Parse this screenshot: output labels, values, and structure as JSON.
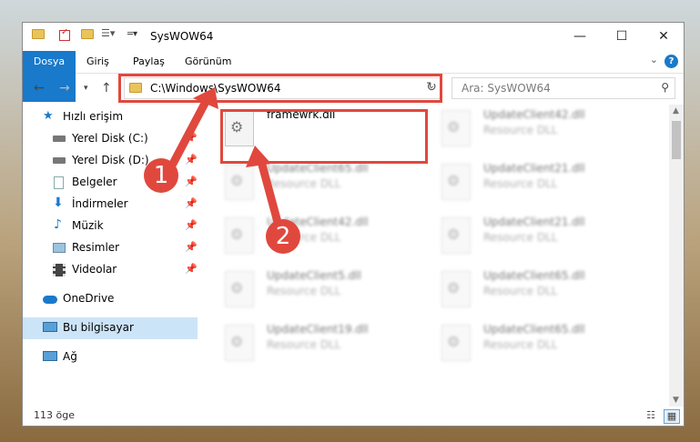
{
  "window": {
    "title": "SysWOW64"
  },
  "ribbon": {
    "tabs": [
      {
        "label": "Dosya"
      },
      {
        "label": "Giriş"
      },
      {
        "label": "Paylaş"
      },
      {
        "label": "Görünüm"
      }
    ],
    "help": "?"
  },
  "address": {
    "path": "C:\\Windows\\SysWOW64"
  },
  "search": {
    "placeholder": "Ara: SysWOW64"
  },
  "nav": {
    "quick_access": "Hızlı erişim",
    "items": [
      {
        "label": "Yerel Disk (C:)",
        "icon": "drive-icon"
      },
      {
        "label": "Yerel Disk (D:)",
        "icon": "drive-icon"
      },
      {
        "label": "Belgeler",
        "icon": "documents-icon"
      },
      {
        "label": "İndirmeler",
        "icon": "downloads-icon"
      },
      {
        "label": "Müzik",
        "icon": "music-icon"
      },
      {
        "label": "Resimler",
        "icon": "pictures-icon"
      },
      {
        "label": "Videolar",
        "icon": "videos-icon"
      }
    ],
    "onedrive": "OneDrive",
    "this_pc": "Bu bilgisayar",
    "network": "Ağ"
  },
  "files": {
    "highlighted": {
      "name": "framewrk.dll"
    },
    "left": [
      {
        "name": "UpdateClient65.dll",
        "type": "Resource DLL"
      },
      {
        "name": "UpdateClient42.dll",
        "type": "Resource DLL"
      },
      {
        "name": "UpdateClient5.dll",
        "type": "Resource DLL"
      },
      {
        "name": "UpdateClient19.dll",
        "type": "Resource DLL"
      }
    ],
    "right": [
      {
        "name": "UpdateClient42.dll",
        "type": "Resource DLL"
      },
      {
        "name": "UpdateClient21.dll",
        "type": "Resource DLL"
      },
      {
        "name": "UpdateClient21.dll",
        "type": "Resource DLL"
      },
      {
        "name": "UpdateClient65.dll",
        "type": "Resource DLL"
      },
      {
        "name": "UpdateClient65.dll",
        "type": "Resource DLL"
      }
    ]
  },
  "status": {
    "count": "113 öge"
  },
  "callouts": {
    "one": "1",
    "two": "2"
  },
  "colors": {
    "accent": "#1979ca",
    "highlight": "#e0483e",
    "selection": "#cce4f7"
  }
}
